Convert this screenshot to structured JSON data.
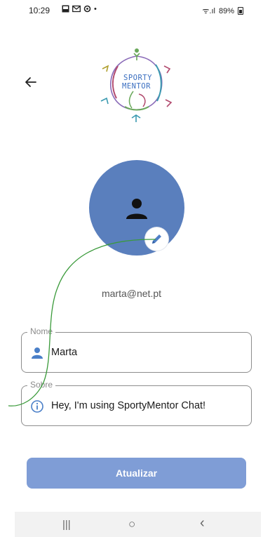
{
  "status_bar": {
    "time": "10:29",
    "notif_icons": [
      "image-icon",
      "mail-icon",
      "settings-icon"
    ],
    "dot": "•",
    "signal": "ᯤ.ıl",
    "battery_text": "89%"
  },
  "header": {
    "back_icon": "arrow-left-icon",
    "logo": {
      "line1": "SPORTY",
      "line2": "MENTOR"
    }
  },
  "profile": {
    "avatar_icon": "person-icon",
    "edit_icon": "pencil-icon",
    "email": "marta@net.pt"
  },
  "form": {
    "name": {
      "label": "Nome",
      "value": "Marta",
      "icon": "person-icon"
    },
    "about": {
      "label": "Sobre",
      "value": "Hey, I'm using SportyMentor Chat!",
      "icon": "info-icon"
    }
  },
  "actions": {
    "update_label": "Atualizar"
  },
  "nav": {
    "recents": "|||",
    "home": "○",
    "back": "‹"
  },
  "colors": {
    "accent": "#5a7fbd",
    "button": "#7f9dd6",
    "gesture_line": "#3a9a3a"
  }
}
